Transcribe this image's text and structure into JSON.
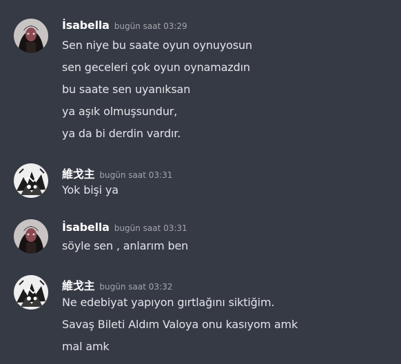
{
  "colors": {
    "background": "#363a45",
    "username": "#ffffff",
    "timestamp": "#a3a6aa",
    "message_text": "#e3e5e8"
  },
  "messages": [
    {
      "author": "İsabella",
      "timestamp": "bugün saat 03:29",
      "avatar_icon": "dark-haired-avatar",
      "lines": [
        "Sen niye bu saate oyun oynuyosun",
        "sen geceleri çok oyun oynamazdın",
        "bu saate sen uyanıksan",
        "ya aşık olmuşsundur,",
        "ya da bi derdin vardır."
      ]
    },
    {
      "author": "維戈主",
      "timestamp": "bugün saat 03:31",
      "avatar_icon": "manga-character-avatar",
      "lines": [
        "Yok bişi ya"
      ]
    },
    {
      "author": "İsabella",
      "timestamp": "bugün saat 03:31",
      "avatar_icon": "dark-haired-avatar",
      "lines": [
        "söyle sen , anlarım ben"
      ]
    },
    {
      "author": "維戈主",
      "timestamp": "bugün saat 03:32",
      "avatar_icon": "manga-character-avatar",
      "lines": [
        "Ne edebiyat yapıyon gırtlağını siktiğim.",
        "Savaş Bileti Aldım Valoya onu kasıyom amk",
        "mal amk"
      ]
    }
  ]
}
